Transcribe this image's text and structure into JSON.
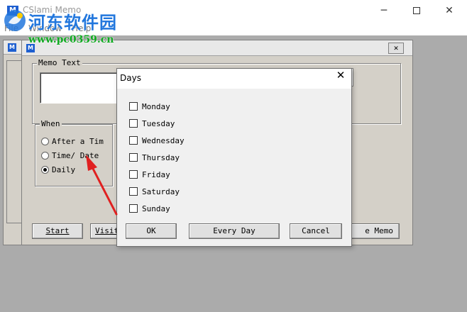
{
  "app": {
    "title": "CSlami Memo",
    "menu": [
      "File",
      "Window",
      "Help"
    ]
  },
  "watermark": {
    "title": "河东软件园",
    "url": "www.pc0359.cn"
  },
  "memo_form": {
    "memo_label": "Memo Text",
    "when_label": "When",
    "radios": [
      {
        "label": "After a Tim",
        "selected": false
      },
      {
        "label": "Time/ Date",
        "selected": false
      },
      {
        "label": "Daily",
        "selected": true
      }
    ],
    "start_label": "Start",
    "visit_label": "Visit",
    "memo_btn_label": "e Memo"
  },
  "days_dialog": {
    "title": "Days",
    "close_glyph": "✕",
    "days": [
      {
        "label": "Monday",
        "checked": false
      },
      {
        "label": "Tuesday",
        "checked": false
      },
      {
        "label": "Wednesday",
        "checked": false
      },
      {
        "label": "Thursday",
        "checked": false
      },
      {
        "label": "Friday",
        "checked": false
      },
      {
        "label": "Saturday",
        "checked": false
      },
      {
        "label": "Sunday",
        "checked": false
      }
    ],
    "ok_label": "OK",
    "everyday_label": "Every Day",
    "cancel_label": "Cancel"
  },
  "colors": {
    "annotation_arrow": "#e02020",
    "watermark_title": "#2277dd",
    "watermark_url": "#11aa22"
  }
}
